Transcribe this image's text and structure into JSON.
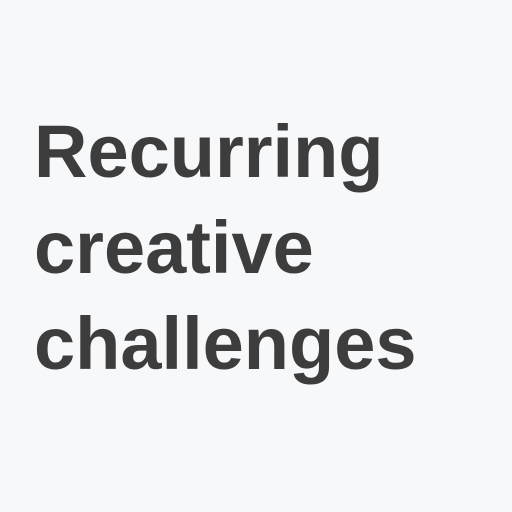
{
  "title": {
    "lines": [
      "Recurring",
      "creative",
      "challenges"
    ]
  },
  "colors": {
    "background": "#f7f8fa",
    "text": "#3d3d3d"
  }
}
